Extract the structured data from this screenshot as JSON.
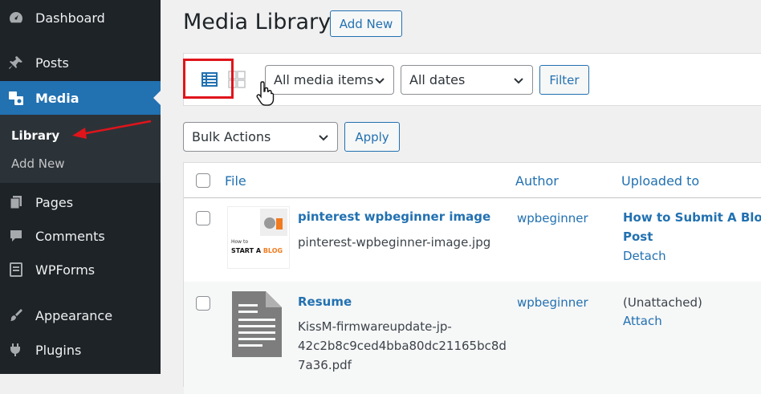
{
  "sidebar": {
    "items": [
      {
        "label": "Dashboard",
        "icon": "dashboard-icon"
      },
      {
        "label": "Posts",
        "icon": "pin-icon"
      },
      {
        "label": "Media",
        "icon": "media-icon"
      },
      {
        "label": "Pages",
        "icon": "pages-icon"
      },
      {
        "label": "Comments",
        "icon": "comments-icon"
      },
      {
        "label": "WPForms",
        "icon": "wpforms-icon"
      },
      {
        "label": "Appearance",
        "icon": "appearance-icon"
      },
      {
        "label": "Plugins",
        "icon": "plugins-icon"
      }
    ],
    "submenu": {
      "library": "Library",
      "add_new": "Add New"
    }
  },
  "header": {
    "title": "Media Library",
    "add_new": "Add New"
  },
  "filters": {
    "media_type": "All media items",
    "dates": "All dates",
    "filter_button": "Filter"
  },
  "bulk": {
    "action": "Bulk Actions",
    "apply": "Apply"
  },
  "table": {
    "columns": {
      "file": "File",
      "author": "Author",
      "uploaded_to": "Uploaded to"
    },
    "rows": [
      {
        "title": "pinterest wpbeginner image",
        "filename": "pinterest-wpbeginner-image.jpg",
        "author": "wpbeginner",
        "uploaded_to": {
          "line1": "How to Submit A Blog",
          "line2": "Post",
          "action": "Detach"
        },
        "thumb": {
          "line1": "How to",
          "line2a": "START A ",
          "line2b": "BLOG"
        }
      },
      {
        "title": "Resume",
        "filename_lines": [
          "KissM-firmwareupdate-jp-",
          "42c2b8c9ced4bba80dc21165bc8d",
          "7a36.pdf"
        ],
        "author": "wpbeginner",
        "uploaded_to": {
          "status": "(Unattached)",
          "action": "Attach"
        }
      }
    ]
  },
  "colors": {
    "accent": "#2271b1",
    "sidebar": "#1d2327",
    "highlight": "#e0141b"
  }
}
